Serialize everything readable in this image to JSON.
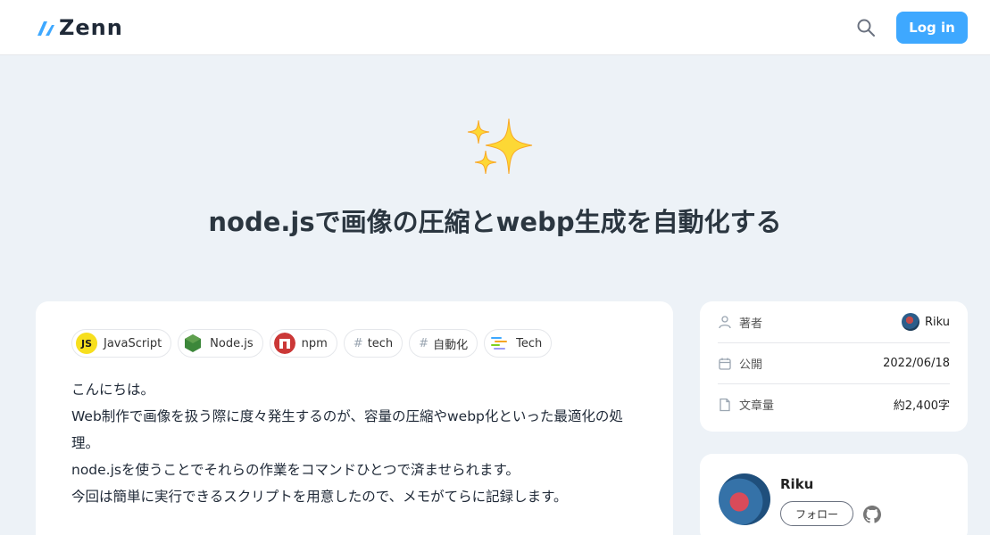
{
  "header": {
    "logo_text": "Zenn",
    "login_label": "Log in",
    "brand_color": "#3ea8ff"
  },
  "article": {
    "emoji": "✨",
    "title": "node.jsで画像の圧縮とwebp生成を自動化する",
    "topics": [
      {
        "label": "JavaScript",
        "icon": "javascript-icon"
      },
      {
        "label": "Node.js",
        "icon": "nodejs-icon"
      },
      {
        "label": "npm",
        "icon": "npm-icon"
      },
      {
        "label": "tech",
        "icon": "hash"
      },
      {
        "label": "自動化",
        "icon": "hash"
      },
      {
        "label": "Tech",
        "icon": "tech-icon"
      }
    ],
    "body_lines": [
      "こんにちは。",
      "Web制作で画像を扱う際に度々発生するのが、容量の圧縮やwebp化といった最適化の処",
      "理。",
      "node.jsを使うことでそれらの作業をコマンドひとつで済ませられます。",
      "今回は簡単に実行できるスクリプトを用意したので、メモがてらに記録します。"
    ]
  },
  "info": {
    "author_label": "著者",
    "author_value": "Riku",
    "published_label": "公開",
    "published_value": "2022/06/18",
    "length_label": "文章量",
    "length_value": "約2,400字"
  },
  "author_card": {
    "name": "Riku",
    "follow_label": "フォロー"
  }
}
